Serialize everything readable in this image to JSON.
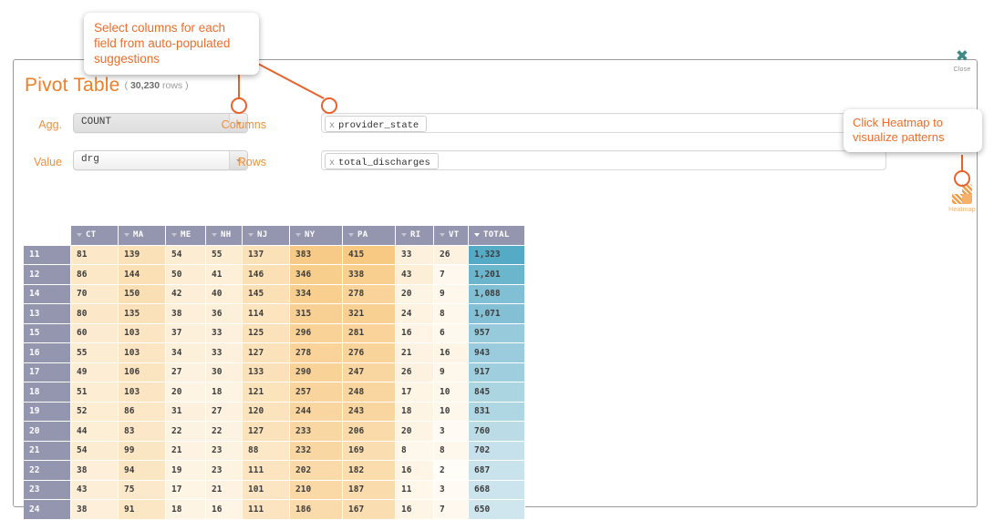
{
  "window": {
    "close_label": "Close",
    "close_icon": "close-x-icon"
  },
  "header": {
    "title": "Pivot Table",
    "rows_prefix": "( ",
    "rows_count": "30,230",
    "rows_suffix": " rows )"
  },
  "controls": {
    "agg_label": "Agg.",
    "agg_value": "COUNT",
    "value_label": "Value",
    "value_value": "drg",
    "columns_label": "Columns",
    "columns_token": "provider_state",
    "rows_label": "Rows",
    "rows_token": "total_discharges",
    "token_remove": "x"
  },
  "heatmap": {
    "label": "Heatmap",
    "icon": "heatmap-icon"
  },
  "callouts": [
    {
      "id": "callout-columns",
      "text": "Select columns for each field from auto-populated suggestions"
    },
    {
      "id": "callout-heatmap",
      "text": "Click Heatmap to visualize patterns"
    }
  ],
  "colors": {
    "accent": "#f07e26",
    "header": "#9496b0",
    "total": "#6fb6cc",
    "close": "#3e8a86"
  },
  "chart_data": {
    "type": "heatmap",
    "title": "Pivot Table",
    "subtitle": "( 30,230 rows )",
    "aggregation": "COUNT",
    "value_field": "drg",
    "column_field": "provider_state",
    "row_field": "total_discharges",
    "row_header": "",
    "categories": [
      "CT",
      "MA",
      "ME",
      "NH",
      "NJ",
      "NY",
      "PA",
      "RI",
      "VT"
    ],
    "total_label": "TOTAL",
    "rows": [
      {
        "key": "11",
        "values": [
          81,
          139,
          54,
          55,
          137,
          383,
          415,
          33,
          26
        ],
        "total": "1,323"
      },
      {
        "key": "12",
        "values": [
          86,
          144,
          50,
          41,
          146,
          346,
          338,
          43,
          7
        ],
        "total": "1,201"
      },
      {
        "key": "14",
        "values": [
          70,
          150,
          42,
          40,
          145,
          334,
          278,
          20,
          9
        ],
        "total": "1,088"
      },
      {
        "key": "13",
        "values": [
          80,
          135,
          38,
          36,
          114,
          315,
          321,
          24,
          8
        ],
        "total": "1,071"
      },
      {
        "key": "15",
        "values": [
          60,
          103,
          37,
          33,
          125,
          296,
          281,
          16,
          6
        ],
        "total": "957"
      },
      {
        "key": "16",
        "values": [
          55,
          103,
          34,
          33,
          127,
          278,
          276,
          21,
          16
        ],
        "total": "943"
      },
      {
        "key": "17",
        "values": [
          49,
          106,
          27,
          30,
          133,
          290,
          247,
          26,
          9
        ],
        "total": "917"
      },
      {
        "key": "18",
        "values": [
          51,
          103,
          20,
          18,
          121,
          257,
          248,
          17,
          10
        ],
        "total": "845"
      },
      {
        "key": "19",
        "values": [
          52,
          86,
          31,
          27,
          120,
          244,
          243,
          18,
          10
        ],
        "total": "831"
      },
      {
        "key": "20",
        "values": [
          44,
          83,
          22,
          22,
          127,
          233,
          206,
          20,
          3
        ],
        "total": "760"
      },
      {
        "key": "21",
        "values": [
          54,
          99,
          21,
          23,
          88,
          232,
          169,
          8,
          8
        ],
        "total": "702"
      },
      {
        "key": "22",
        "values": [
          38,
          94,
          19,
          23,
          111,
          202,
          182,
          16,
          2
        ],
        "total": "687"
      },
      {
        "key": "23",
        "values": [
          43,
          75,
          17,
          21,
          101,
          210,
          187,
          11,
          3
        ],
        "total": "668"
      },
      {
        "key": "24",
        "values": [
          38,
          91,
          18,
          16,
          111,
          186,
          167,
          16,
          7
        ],
        "total": "650"
      }
    ],
    "colorscale_cells": [
      "#fffdf8",
      "#f7c982"
    ],
    "colorscale_total": [
      "#cfe6ee",
      "#55aac6"
    ],
    "value_min": 2,
    "value_max": 415,
    "total_min": 650,
    "total_max": 1323
  }
}
